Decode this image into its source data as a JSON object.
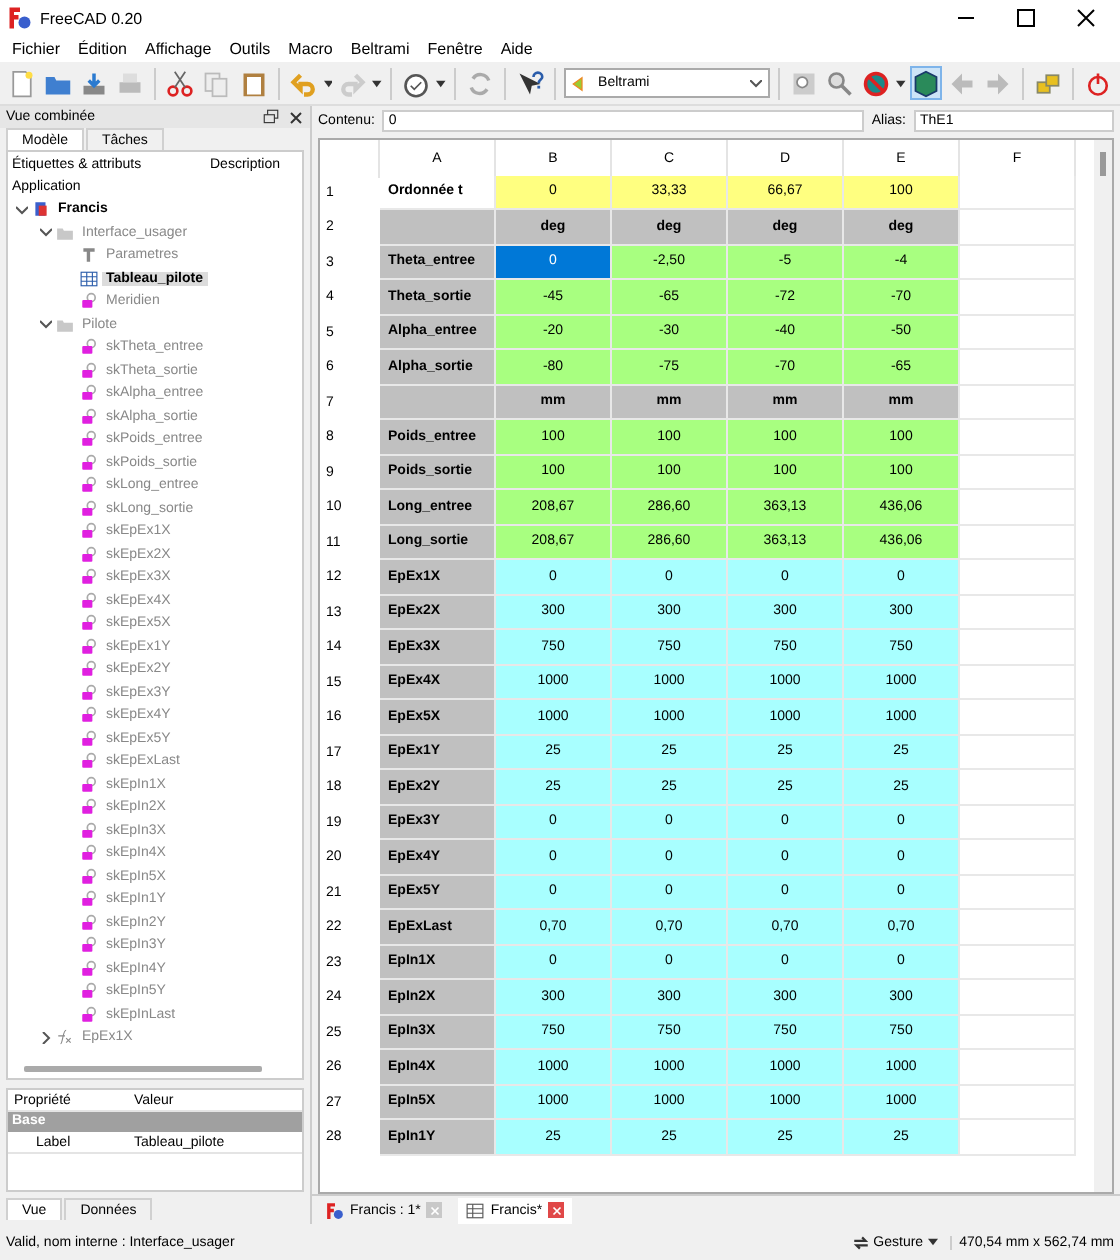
{
  "window": {
    "title": "FreeCAD 0.20"
  },
  "menu": [
    "Fichier",
    "Édition",
    "Affichage",
    "Outils",
    "Macro",
    "Beltrami",
    "Fenêtre",
    "Aide"
  ],
  "workbench": {
    "value": "Beltrami"
  },
  "combo_view": {
    "title": "Vue combinée",
    "tabs": [
      {
        "label": "Modèle",
        "selected": true
      },
      {
        "label": "Tâches",
        "selected": false
      }
    ],
    "tree": {
      "columns": [
        "Étiquettes & attributs",
        "Description"
      ],
      "root_label": "Application",
      "items": [
        {
          "label": "Francis",
          "kind": "document",
          "expanded": true,
          "selected": false,
          "children": [
            {
              "label": "Interface_usager",
              "kind": "folder",
              "expanded": true,
              "selected": false,
              "children": [
                {
                  "label": "Parametres",
                  "kind": "part",
                  "selected": false
                },
                {
                  "label": "Tableau_pilote",
                  "kind": "spreadsheet",
                  "selected": true
                },
                {
                  "label": "Meridien",
                  "kind": "sketch",
                  "selected": false
                }
              ]
            },
            {
              "label": "Pilote",
              "kind": "folder",
              "expanded": true,
              "selected": false,
              "children": [
                {
                  "label": "skTheta_entree",
                  "kind": "sketch",
                  "selected": false
                },
                {
                  "label": "skTheta_sortie",
                  "kind": "sketch",
                  "selected": false
                },
                {
                  "label": "skAlpha_entree",
                  "kind": "sketch",
                  "selected": false
                },
                {
                  "label": "skAlpha_sortie",
                  "kind": "sketch",
                  "selected": false
                },
                {
                  "label": "skPoids_entree",
                  "kind": "sketch",
                  "selected": false
                },
                {
                  "label": "skPoids_sortie",
                  "kind": "sketch",
                  "selected": false
                },
                {
                  "label": "skLong_entree",
                  "kind": "sketch",
                  "selected": false
                },
                {
                  "label": "skLong_sortie",
                  "kind": "sketch",
                  "selected": false
                },
                {
                  "label": "skEpEx1X",
                  "kind": "sketch",
                  "selected": false
                },
                {
                  "label": "skEpEx2X",
                  "kind": "sketch",
                  "selected": false
                },
                {
                  "label": "skEpEx3X",
                  "kind": "sketch",
                  "selected": false
                },
                {
                  "label": "skEpEx4X",
                  "kind": "sketch",
                  "selected": false
                },
                {
                  "label": "skEpEx5X",
                  "kind": "sketch",
                  "selected": false
                },
                {
                  "label": "skEpEx1Y",
                  "kind": "sketch",
                  "selected": false
                },
                {
                  "label": "skEpEx2Y",
                  "kind": "sketch",
                  "selected": false
                },
                {
                  "label": "skEpEx3Y",
                  "kind": "sketch",
                  "selected": false
                },
                {
                  "label": "skEpEx4Y",
                  "kind": "sketch",
                  "selected": false
                },
                {
                  "label": "skEpEx5Y",
                  "kind": "sketch",
                  "selected": false
                },
                {
                  "label": "skEpExLast",
                  "kind": "sketch",
                  "selected": false
                },
                {
                  "label": "skEpIn1X",
                  "kind": "sketch",
                  "selected": false
                },
                {
                  "label": "skEpIn2X",
                  "kind": "sketch",
                  "selected": false
                },
                {
                  "label": "skEpIn3X",
                  "kind": "sketch",
                  "selected": false
                },
                {
                  "label": "skEpIn4X",
                  "kind": "sketch",
                  "selected": false
                },
                {
                  "label": "skEpIn5X",
                  "kind": "sketch",
                  "selected": false
                },
                {
                  "label": "skEpIn1Y",
                  "kind": "sketch",
                  "selected": false
                },
                {
                  "label": "skEpIn2Y",
                  "kind": "sketch",
                  "selected": false
                },
                {
                  "label": "skEpIn3Y",
                  "kind": "sketch",
                  "selected": false
                },
                {
                  "label": "skEpIn4Y",
                  "kind": "sketch",
                  "selected": false
                },
                {
                  "label": "skEpIn5Y",
                  "kind": "sketch",
                  "selected": false
                },
                {
                  "label": "skEpInLast",
                  "kind": "sketch",
                  "selected": false
                }
              ]
            },
            {
              "label": "EpEx1X",
              "kind": "formula",
              "expanded": false,
              "selected": false
            }
          ]
        }
      ]
    },
    "properties": {
      "columns": [
        "Propriété",
        "Valeur"
      ],
      "group": "Base",
      "rows": [
        {
          "name": "Label",
          "value": "Tableau_pilote"
        }
      ]
    },
    "bottom_tabs": [
      {
        "label": "Vue",
        "selected": true
      },
      {
        "label": "Données",
        "selected": false
      }
    ]
  },
  "sheet": {
    "content_label": "Contenu:",
    "content_value": "0",
    "alias_label": "Alias:",
    "alias_value": "ThE1",
    "columns": [
      "A",
      "B",
      "C",
      "D",
      "E",
      "F"
    ],
    "rows": [
      {
        "number": "1",
        "kind": "title",
        "color": "#ffff80",
        "cells": [
          {
            "text": "Ordonnée t",
            "selected": false
          },
          {
            "text": "0",
            "selected": false
          },
          {
            "text": "33,33",
            "selected": false
          },
          {
            "text": "66,67",
            "selected": false
          },
          {
            "text": "100",
            "selected": false
          }
        ]
      },
      {
        "number": "2",
        "kind": "unit",
        "color": "#c0c0c0",
        "cells": [
          {
            "text": "",
            "selected": false
          },
          {
            "text": "deg",
            "selected": false
          },
          {
            "text": "deg",
            "selected": false
          },
          {
            "text": "deg",
            "selected": false
          },
          {
            "text": "deg",
            "selected": false
          }
        ]
      },
      {
        "number": "3",
        "kind": "data",
        "color": "#a8ff80",
        "cells": [
          {
            "text": "Theta_entree",
            "selected": false
          },
          {
            "text": "0",
            "selected": true
          },
          {
            "text": "-2,50",
            "selected": false
          },
          {
            "text": "-5",
            "selected": false
          },
          {
            "text": "-4",
            "selected": false
          }
        ]
      },
      {
        "number": "4",
        "kind": "data",
        "color": "#a8ff80",
        "cells": [
          {
            "text": "Theta_sortie",
            "selected": false
          },
          {
            "text": "-45",
            "selected": false
          },
          {
            "text": "-65",
            "selected": false
          },
          {
            "text": "-72",
            "selected": false
          },
          {
            "text": "-70",
            "selected": false
          }
        ]
      },
      {
        "number": "5",
        "kind": "data",
        "color": "#a8ff80",
        "cells": [
          {
            "text": "Alpha_entree",
            "selected": false
          },
          {
            "text": "-20",
            "selected": false
          },
          {
            "text": "-30",
            "selected": false
          },
          {
            "text": "-40",
            "selected": false
          },
          {
            "text": "-50",
            "selected": false
          }
        ]
      },
      {
        "number": "6",
        "kind": "data",
        "color": "#a8ff80",
        "cells": [
          {
            "text": "Alpha_sortie",
            "selected": false
          },
          {
            "text": "-80",
            "selected": false
          },
          {
            "text": "-75",
            "selected": false
          },
          {
            "text": "-70",
            "selected": false
          },
          {
            "text": "-65",
            "selected": false
          }
        ]
      },
      {
        "number": "7",
        "kind": "unit",
        "color": "#c0c0c0",
        "cells": [
          {
            "text": "",
            "selected": false
          },
          {
            "text": "mm",
            "selected": false
          },
          {
            "text": "mm",
            "selected": false
          },
          {
            "text": "mm",
            "selected": false
          },
          {
            "text": "mm",
            "selected": false
          }
        ]
      },
      {
        "number": "8",
        "kind": "data",
        "color": "#a8ff80",
        "cells": [
          {
            "text": "Poids_entree",
            "selected": false
          },
          {
            "text": "100",
            "selected": false
          },
          {
            "text": "100",
            "selected": false
          },
          {
            "text": "100",
            "selected": false
          },
          {
            "text": "100",
            "selected": false
          }
        ]
      },
      {
        "number": "9",
        "kind": "data",
        "color": "#a8ff80",
        "cells": [
          {
            "text": "Poids_sortie",
            "selected": false
          },
          {
            "text": "100",
            "selected": false
          },
          {
            "text": "100",
            "selected": false
          },
          {
            "text": "100",
            "selected": false
          },
          {
            "text": "100",
            "selected": false
          }
        ]
      },
      {
        "number": "10",
        "kind": "data",
        "color": "#a8ff80",
        "cells": [
          {
            "text": "Long_entree",
            "selected": false
          },
          {
            "text": "208,67",
            "selected": false
          },
          {
            "text": "286,60",
            "selected": false
          },
          {
            "text": "363,13",
            "selected": false
          },
          {
            "text": "436,06",
            "selected": false
          }
        ]
      },
      {
        "number": "11",
        "kind": "data",
        "color": "#a8ff80",
        "cells": [
          {
            "text": "Long_sortie",
            "selected": false
          },
          {
            "text": "208,67",
            "selected": false
          },
          {
            "text": "286,60",
            "selected": false
          },
          {
            "text": "363,13",
            "selected": false
          },
          {
            "text": "436,06",
            "selected": false
          }
        ]
      },
      {
        "number": "12",
        "kind": "data",
        "color": "#a8ffff",
        "cells": [
          {
            "text": "EpEx1X",
            "selected": false
          },
          {
            "text": "0",
            "selected": false
          },
          {
            "text": "0",
            "selected": false
          },
          {
            "text": "0",
            "selected": false
          },
          {
            "text": "0",
            "selected": false
          }
        ]
      },
      {
        "number": "13",
        "kind": "data",
        "color": "#a8ffff",
        "cells": [
          {
            "text": "EpEx2X",
            "selected": false
          },
          {
            "text": "300",
            "selected": false
          },
          {
            "text": "300",
            "selected": false
          },
          {
            "text": "300",
            "selected": false
          },
          {
            "text": "300",
            "selected": false
          }
        ]
      },
      {
        "number": "14",
        "kind": "data",
        "color": "#a8ffff",
        "cells": [
          {
            "text": "EpEx3X",
            "selected": false
          },
          {
            "text": "750",
            "selected": false
          },
          {
            "text": "750",
            "selected": false
          },
          {
            "text": "750",
            "selected": false
          },
          {
            "text": "750",
            "selected": false
          }
        ]
      },
      {
        "number": "15",
        "kind": "data",
        "color": "#a8ffff",
        "cells": [
          {
            "text": "EpEx4X",
            "selected": false
          },
          {
            "text": "1000",
            "selected": false
          },
          {
            "text": "1000",
            "selected": false
          },
          {
            "text": "1000",
            "selected": false
          },
          {
            "text": "1000",
            "selected": false
          }
        ]
      },
      {
        "number": "16",
        "kind": "data",
        "color": "#a8ffff",
        "cells": [
          {
            "text": "EpEx5X",
            "selected": false
          },
          {
            "text": "1000",
            "selected": false
          },
          {
            "text": "1000",
            "selected": false
          },
          {
            "text": "1000",
            "selected": false
          },
          {
            "text": "1000",
            "selected": false
          }
        ]
      },
      {
        "number": "17",
        "kind": "data",
        "color": "#a8ffff",
        "cells": [
          {
            "text": "EpEx1Y",
            "selected": false
          },
          {
            "text": "25",
            "selected": false
          },
          {
            "text": "25",
            "selected": false
          },
          {
            "text": "25",
            "selected": false
          },
          {
            "text": "25",
            "selected": false
          }
        ]
      },
      {
        "number": "18",
        "kind": "data",
        "color": "#a8ffff",
        "cells": [
          {
            "text": "EpEx2Y",
            "selected": false
          },
          {
            "text": "25",
            "selected": false
          },
          {
            "text": "25",
            "selected": false
          },
          {
            "text": "25",
            "selected": false
          },
          {
            "text": "25",
            "selected": false
          }
        ]
      },
      {
        "number": "19",
        "kind": "data",
        "color": "#a8ffff",
        "cells": [
          {
            "text": "EpEx3Y",
            "selected": false
          },
          {
            "text": "0",
            "selected": false
          },
          {
            "text": "0",
            "selected": false
          },
          {
            "text": "0",
            "selected": false
          },
          {
            "text": "0",
            "selected": false
          }
        ]
      },
      {
        "number": "20",
        "kind": "data",
        "color": "#a8ffff",
        "cells": [
          {
            "text": "EpEx4Y",
            "selected": false
          },
          {
            "text": "0",
            "selected": false
          },
          {
            "text": "0",
            "selected": false
          },
          {
            "text": "0",
            "selected": false
          },
          {
            "text": "0",
            "selected": false
          }
        ]
      },
      {
        "number": "21",
        "kind": "data",
        "color": "#a8ffff",
        "cells": [
          {
            "text": "EpEx5Y",
            "selected": false
          },
          {
            "text": "0",
            "selected": false
          },
          {
            "text": "0",
            "selected": false
          },
          {
            "text": "0",
            "selected": false
          },
          {
            "text": "0",
            "selected": false
          }
        ]
      },
      {
        "number": "22",
        "kind": "data",
        "color": "#a8ffff",
        "cells": [
          {
            "text": "EpExLast",
            "selected": false
          },
          {
            "text": "0,70",
            "selected": false
          },
          {
            "text": "0,70",
            "selected": false
          },
          {
            "text": "0,70",
            "selected": false
          },
          {
            "text": "0,70",
            "selected": false
          }
        ]
      },
      {
        "number": "23",
        "kind": "data",
        "color": "#a8ffff",
        "cells": [
          {
            "text": "EpIn1X",
            "selected": false
          },
          {
            "text": "0",
            "selected": false
          },
          {
            "text": "0",
            "selected": false
          },
          {
            "text": "0",
            "selected": false
          },
          {
            "text": "0",
            "selected": false
          }
        ]
      },
      {
        "number": "24",
        "kind": "data",
        "color": "#a8ffff",
        "cells": [
          {
            "text": "EpIn2X",
            "selected": false
          },
          {
            "text": "300",
            "selected": false
          },
          {
            "text": "300",
            "selected": false
          },
          {
            "text": "300",
            "selected": false
          },
          {
            "text": "300",
            "selected": false
          }
        ]
      },
      {
        "number": "25",
        "kind": "data",
        "color": "#a8ffff",
        "cells": [
          {
            "text": "EpIn3X",
            "selected": false
          },
          {
            "text": "750",
            "selected": false
          },
          {
            "text": "750",
            "selected": false
          },
          {
            "text": "750",
            "selected": false
          },
          {
            "text": "750",
            "selected": false
          }
        ]
      },
      {
        "number": "26",
        "kind": "data",
        "color": "#a8ffff",
        "cells": [
          {
            "text": "EpIn4X",
            "selected": false
          },
          {
            "text": "1000",
            "selected": false
          },
          {
            "text": "1000",
            "selected": false
          },
          {
            "text": "1000",
            "selected": false
          },
          {
            "text": "1000",
            "selected": false
          }
        ]
      },
      {
        "number": "27",
        "kind": "data",
        "color": "#a8ffff",
        "cells": [
          {
            "text": "EpIn5X",
            "selected": false
          },
          {
            "text": "1000",
            "selected": false
          },
          {
            "text": "1000",
            "selected": false
          },
          {
            "text": "1000",
            "selected": false
          },
          {
            "text": "1000",
            "selected": false
          }
        ]
      },
      {
        "number": "28",
        "kind": "data",
        "color": "#a8ffff",
        "cells": [
          {
            "text": "EpIn1Y",
            "selected": false
          },
          {
            "text": "25",
            "selected": false
          },
          {
            "text": "25",
            "selected": false
          },
          {
            "text": "25",
            "selected": false
          },
          {
            "text": "25",
            "selected": false
          }
        ]
      }
    ]
  },
  "document_tabs": [
    {
      "label": "Francis : 1*",
      "kind": "model",
      "selected": false
    },
    {
      "label": "Francis*",
      "kind": "sheet",
      "selected": true
    }
  ],
  "status_bar": {
    "message": "Valid, nom interne : Interface_usager",
    "navigation": "Gesture",
    "dimensions": "470,54 mm x 562,74 mm"
  }
}
